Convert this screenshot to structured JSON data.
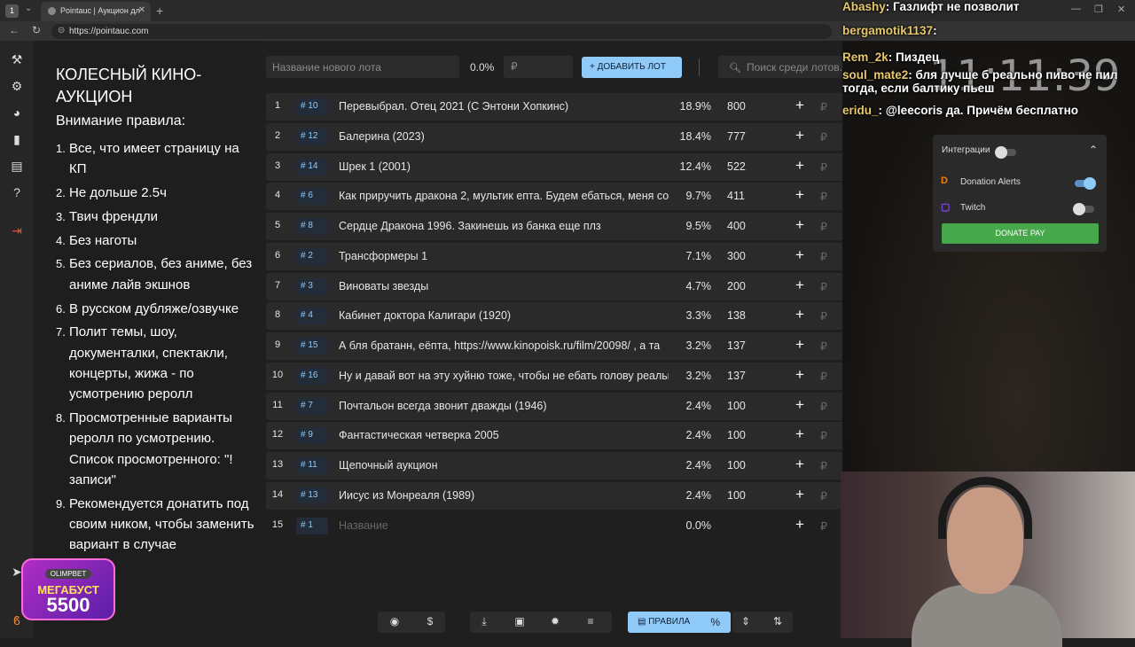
{
  "browser": {
    "tab_title": "Pointauc | Аукцион дл",
    "url": "https://pointauc.com"
  },
  "rules_panel": {
    "title": "КОЛЕСНЫЙ КИНО-АУКЦИОН",
    "subtitle": "Внимание правила:",
    "items": [
      {
        "n": "1.",
        "text": "Все, что имеет страницу на КП"
      },
      {
        "n": "2.",
        "text": "Не дольше 2.5ч"
      },
      {
        "n": "3.",
        "text": "Твич френдли"
      },
      {
        "n": "4.",
        "text": "Без наготы"
      },
      {
        "n": "5.",
        "text": "Без сериалов, без аниме, без аниме лайв экшнов"
      },
      {
        "n": "6.",
        "text": "В русском дубляже/озвучке"
      },
      {
        "n": "7.",
        "text": "Полит темы, шоу, документалки, спектакли, концерты, жижа - по усмотрению реролл"
      },
      {
        "n": "8.",
        "text": "Просмотренные варианты реролл по усмотрению. Список просмотренного: \"! записи\""
      },
      {
        "n": "9.",
        "text": "Рекомендуется донатить под своим ником, чтобы заменить вариант в случае"
      }
    ],
    "promo": {
      "brand": "OLIMPBET",
      "line1": "МЕГАБУСТ",
      "line2": "5500"
    }
  },
  "top_bar": {
    "new_lot_placeholder": "Название нового лота",
    "percent": "0.0%",
    "currency_placeholder": "₽",
    "add_button": "ДОБАВИТЬ ЛОТ",
    "search_placeholder": "Поиск среди лотов..."
  },
  "lots": [
    {
      "pos": "1",
      "id": "10",
      "title": "Перевыбрал. Отец 2021 (С Энтони Хопкинс)",
      "share": "18.9%",
      "amount": "800"
    },
    {
      "pos": "2",
      "id": "12",
      "title": "Балерина (2023)",
      "share": "18.4%",
      "amount": "777"
    },
    {
      "pos": "3",
      "id": "14",
      "title": "Шрек 1 (2001)",
      "share": "12.4%",
      "amount": "522"
    },
    {
      "pos": "4",
      "id": "6",
      "title": "Как приручить дракона 2, мультик епта. Будем ебаться, меня сос",
      "share": "9.7%",
      "amount": "411"
    },
    {
      "pos": "5",
      "id": "8",
      "title": "Сердце Дракона 1996. Закинешь из банка еще плз",
      "share": "9.5%",
      "amount": "400"
    },
    {
      "pos": "6",
      "id": "2",
      "title": "Трансформеры 1",
      "share": "7.1%",
      "amount": "300"
    },
    {
      "pos": "7",
      "id": "3",
      "title": "Виноваты звезды",
      "share": "4.7%",
      "amount": "200"
    },
    {
      "pos": "8",
      "id": "4",
      "title": "Кабинет доктора Калигари (1920)",
      "share": "3.3%",
      "amount": "138"
    },
    {
      "pos": "9",
      "id": "15",
      "title": "А бля братанн, еёпта, https://www.kinopoisk.ru/film/20098/ , а та",
      "share": "3.2%",
      "amount": "137"
    },
    {
      "pos": "10",
      "id": "16",
      "title": "Ну и давай вот на эту хуйню тоже, чтобы не ебать голову реальн",
      "share": "3.2%",
      "amount": "137"
    },
    {
      "pos": "11",
      "id": "7",
      "title": "Почтальон всегда звонит дважды (1946)",
      "share": "2.4%",
      "amount": "100"
    },
    {
      "pos": "12",
      "id": "9",
      "title": "Фантастическая четверка 2005",
      "share": "2.4%",
      "amount": "100"
    },
    {
      "pos": "13",
      "id": "11",
      "title": "Щепочный аукцион",
      "share": "2.4%",
      "amount": "100"
    },
    {
      "pos": "14",
      "id": "13",
      "title": "Иисус из Монреаля (1989)",
      "share": "2.4%",
      "amount": "100"
    },
    {
      "pos": "15",
      "id": "1",
      "title": "",
      "placeholder": "Название",
      "share": "0.0%",
      "amount": ""
    }
  ],
  "row_symbols": {
    "hash": "#",
    "plus": "+",
    "currency": "₽"
  },
  "bottom_toolbar": {
    "rules_button": "ПРАВИЛА",
    "percent_icon": "%"
  },
  "integrations": {
    "title": "Интеграции",
    "donation_alerts": {
      "label": "Donation Alerts",
      "enabled": true
    },
    "twitch": {
      "label": "Twitch",
      "enabled": false
    },
    "donate_pay": "DONATE PAY"
  },
  "overlay": {
    "clock": "11:11:39",
    "chat": [
      {
        "user": "Abashy",
        "msg": "Газлифт не позволит"
      },
      {
        "user": "bergamotik1137",
        "msg": ""
      },
      {
        "user": "Rem_2k",
        "msg": "Пиздец"
      },
      {
        "user": "soul_mate2",
        "msg": "бля лучше б реально пиво не пил тогда, если балтику пьеш"
      },
      {
        "user": "eridu_",
        "msg": "@leecoris да. Причём бесплатно"
      }
    ]
  },
  "colors": {
    "accent": "#90caf9",
    "donate_green": "#47a84b",
    "row_bg": "#2a2a2a",
    "page_bg": "#1f1f1f"
  }
}
